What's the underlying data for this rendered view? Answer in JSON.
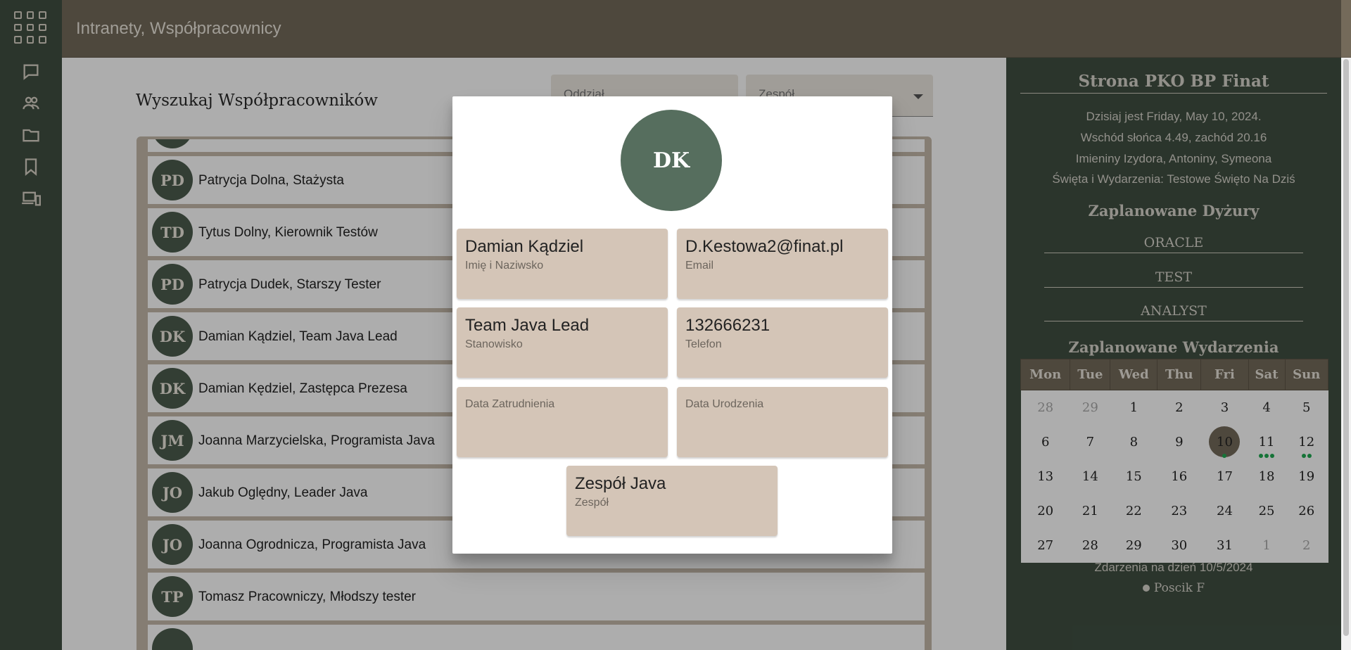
{
  "header": {
    "title": "Intranety, Współpracownicy"
  },
  "rail": {
    "icons": [
      "apps-grid-icon",
      "chat-icon",
      "people-icon",
      "folder-icon",
      "bookmark-icon",
      "devices-icon"
    ]
  },
  "search": {
    "heading": "Wyszukaj Współpracowników",
    "filter_department_placeholder": "Oddział",
    "filter_team_placeholder": "Zespół"
  },
  "employees": [
    {
      "initials": "PD",
      "name": "Patrycja Dolna, Stażysta"
    },
    {
      "initials": "TD",
      "name": "Tytus Dolny, Kierownik Testów"
    },
    {
      "initials": "PD",
      "name": "Patrycja Dudek, Starszy Tester"
    },
    {
      "initials": "DK",
      "name": "Damian Kądziel, Team Java Lead"
    },
    {
      "initials": "DK",
      "name": "Damian Kędziel, Zastępca Prezesa"
    },
    {
      "initials": "JM",
      "name": "Joanna Marzycielska, Programista Java"
    },
    {
      "initials": "JO",
      "name": "Jakub Oględny, Leader Java"
    },
    {
      "initials": "JO",
      "name": "Joanna Ogrodnicza, Programista Java"
    },
    {
      "initials": "TP",
      "name": "Tomasz Pracowniczy, Młodszy tester"
    }
  ],
  "modal": {
    "initials": "DK",
    "name_value": "Damian Kądziel",
    "name_label": "Imię i Naziwsko",
    "email_value": "D.Kestowa2@finat.pl",
    "email_label": "Email",
    "position_value": "Team Java Lead",
    "position_label": "Stanowisko",
    "phone_value": "132666231",
    "phone_label": "Telefon",
    "hire_date_value": "",
    "hire_date_label": "Data Zatrudnienia",
    "birth_date_value": "",
    "birth_date_label": "Data Urodzenia",
    "team_value": "Zespół Java",
    "team_label": "Zespół"
  },
  "panel": {
    "title": "Strona PKO BP Finat",
    "today": "Dzisiaj jest Friday, May 10, 2024.",
    "sun": "Wschód słońca 4.49, zachód 20.16",
    "namedays": "Imieniny Izydora, Antoniny, Symeona",
    "holidays": "Święta i Wydarzenia: Testowe Święto Na Dziś",
    "duties_title": "Zaplanowane Dyżury",
    "duties": [
      "ORACLE",
      "TEST",
      "ANALYST"
    ],
    "events_title": "Zaplanowane Wydarzenia",
    "calendar": {
      "weekdays": [
        "Mon",
        "Tue",
        "Wed",
        "Thu",
        "Fri",
        "Sat",
        "Sun"
      ],
      "selected_day": 10,
      "weeks": [
        [
          {
            "d": "28",
            "o": true
          },
          {
            "d": "29",
            "o": true
          },
          {
            "d": "1"
          },
          {
            "d": "2"
          },
          {
            "d": "3"
          },
          {
            "d": "4"
          },
          {
            "d": "5"
          }
        ],
        [
          {
            "d": "6"
          },
          {
            "d": "7"
          },
          {
            "d": "8"
          },
          {
            "d": "9"
          },
          {
            "d": "10",
            "dots": 1
          },
          {
            "d": "11",
            "dots": 3
          },
          {
            "d": "12",
            "dots": 2
          }
        ],
        [
          {
            "d": "13"
          },
          {
            "d": "14"
          },
          {
            "d": "15"
          },
          {
            "d": "16"
          },
          {
            "d": "17"
          },
          {
            "d": "18"
          },
          {
            "d": "19"
          }
        ],
        [
          {
            "d": "20"
          },
          {
            "d": "21"
          },
          {
            "d": "22"
          },
          {
            "d": "23"
          },
          {
            "d": "24"
          },
          {
            "d": "25"
          },
          {
            "d": "26"
          }
        ],
        [
          {
            "d": "27"
          },
          {
            "d": "28"
          },
          {
            "d": "29"
          },
          {
            "d": "30"
          },
          {
            "d": "31"
          },
          {
            "d": "1",
            "o": true
          },
          {
            "d": "2",
            "o": true
          }
        ]
      ]
    },
    "events_for_day": "Zdarzenia na dzień 10/5/2024",
    "event_items": [
      "Poscik F"
    ],
    "colors": {
      "event_dot": "#1faa52",
      "selected_day": "#746a5a"
    }
  }
}
